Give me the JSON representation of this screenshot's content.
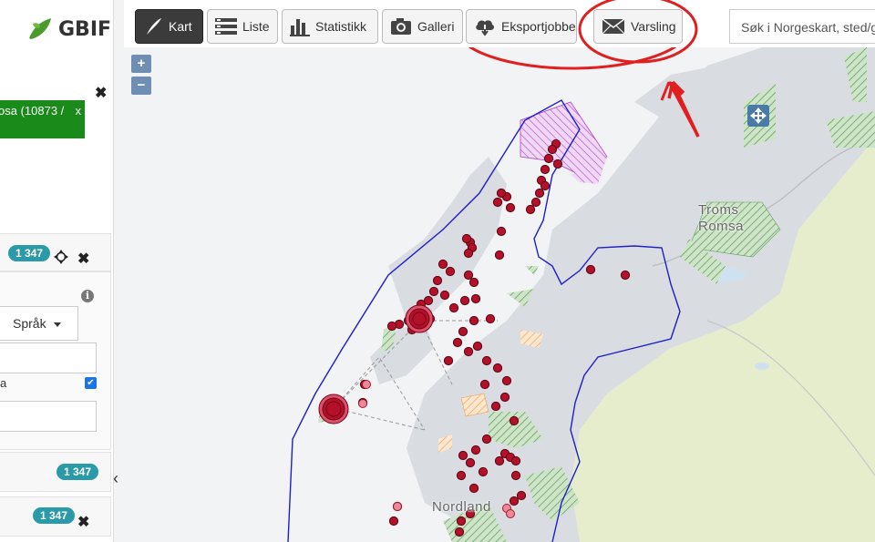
{
  "sidebar": {
    "logo_text": "GBIF",
    "filter_chip": {
      "label": "osa (10873 /",
      "close": "x"
    },
    "panel1": {
      "count": "1 347"
    },
    "language_select": {
      "label": "Språk"
    },
    "checkbox_label": "a",
    "panel2": {
      "count": "1 347"
    },
    "panel3": {
      "count": "1 347"
    },
    "collapse_icon": "‹"
  },
  "toolbar": {
    "buttons": [
      {
        "label": "Kart",
        "icon": "norway-map-icon",
        "active": true
      },
      {
        "label": "Liste",
        "icon": "list-icon"
      },
      {
        "label": "Statistikk",
        "icon": "bar-chart-icon"
      },
      {
        "label": "Galleri",
        "icon": "camera-icon"
      },
      {
        "label": "Eksportjobber",
        "icon": "cloud-download-icon"
      },
      {
        "label": "Varsling",
        "icon": "envelope-icon"
      }
    ],
    "search_placeholder": "Søk i Norgeskart, sted/g"
  },
  "map": {
    "zoom_in": "+",
    "zoom_out": "−",
    "labels": {
      "troms": "Troms",
      "romsa": "Romsa",
      "nordland": "Nordland"
    },
    "colors": {
      "sea": "#f2f3f5",
      "land": "#d9dde2",
      "forest": "#e6edcc",
      "boundary": "#1f1fc8",
      "observation": "#b3112a",
      "annotation": "#e02020"
    }
  }
}
